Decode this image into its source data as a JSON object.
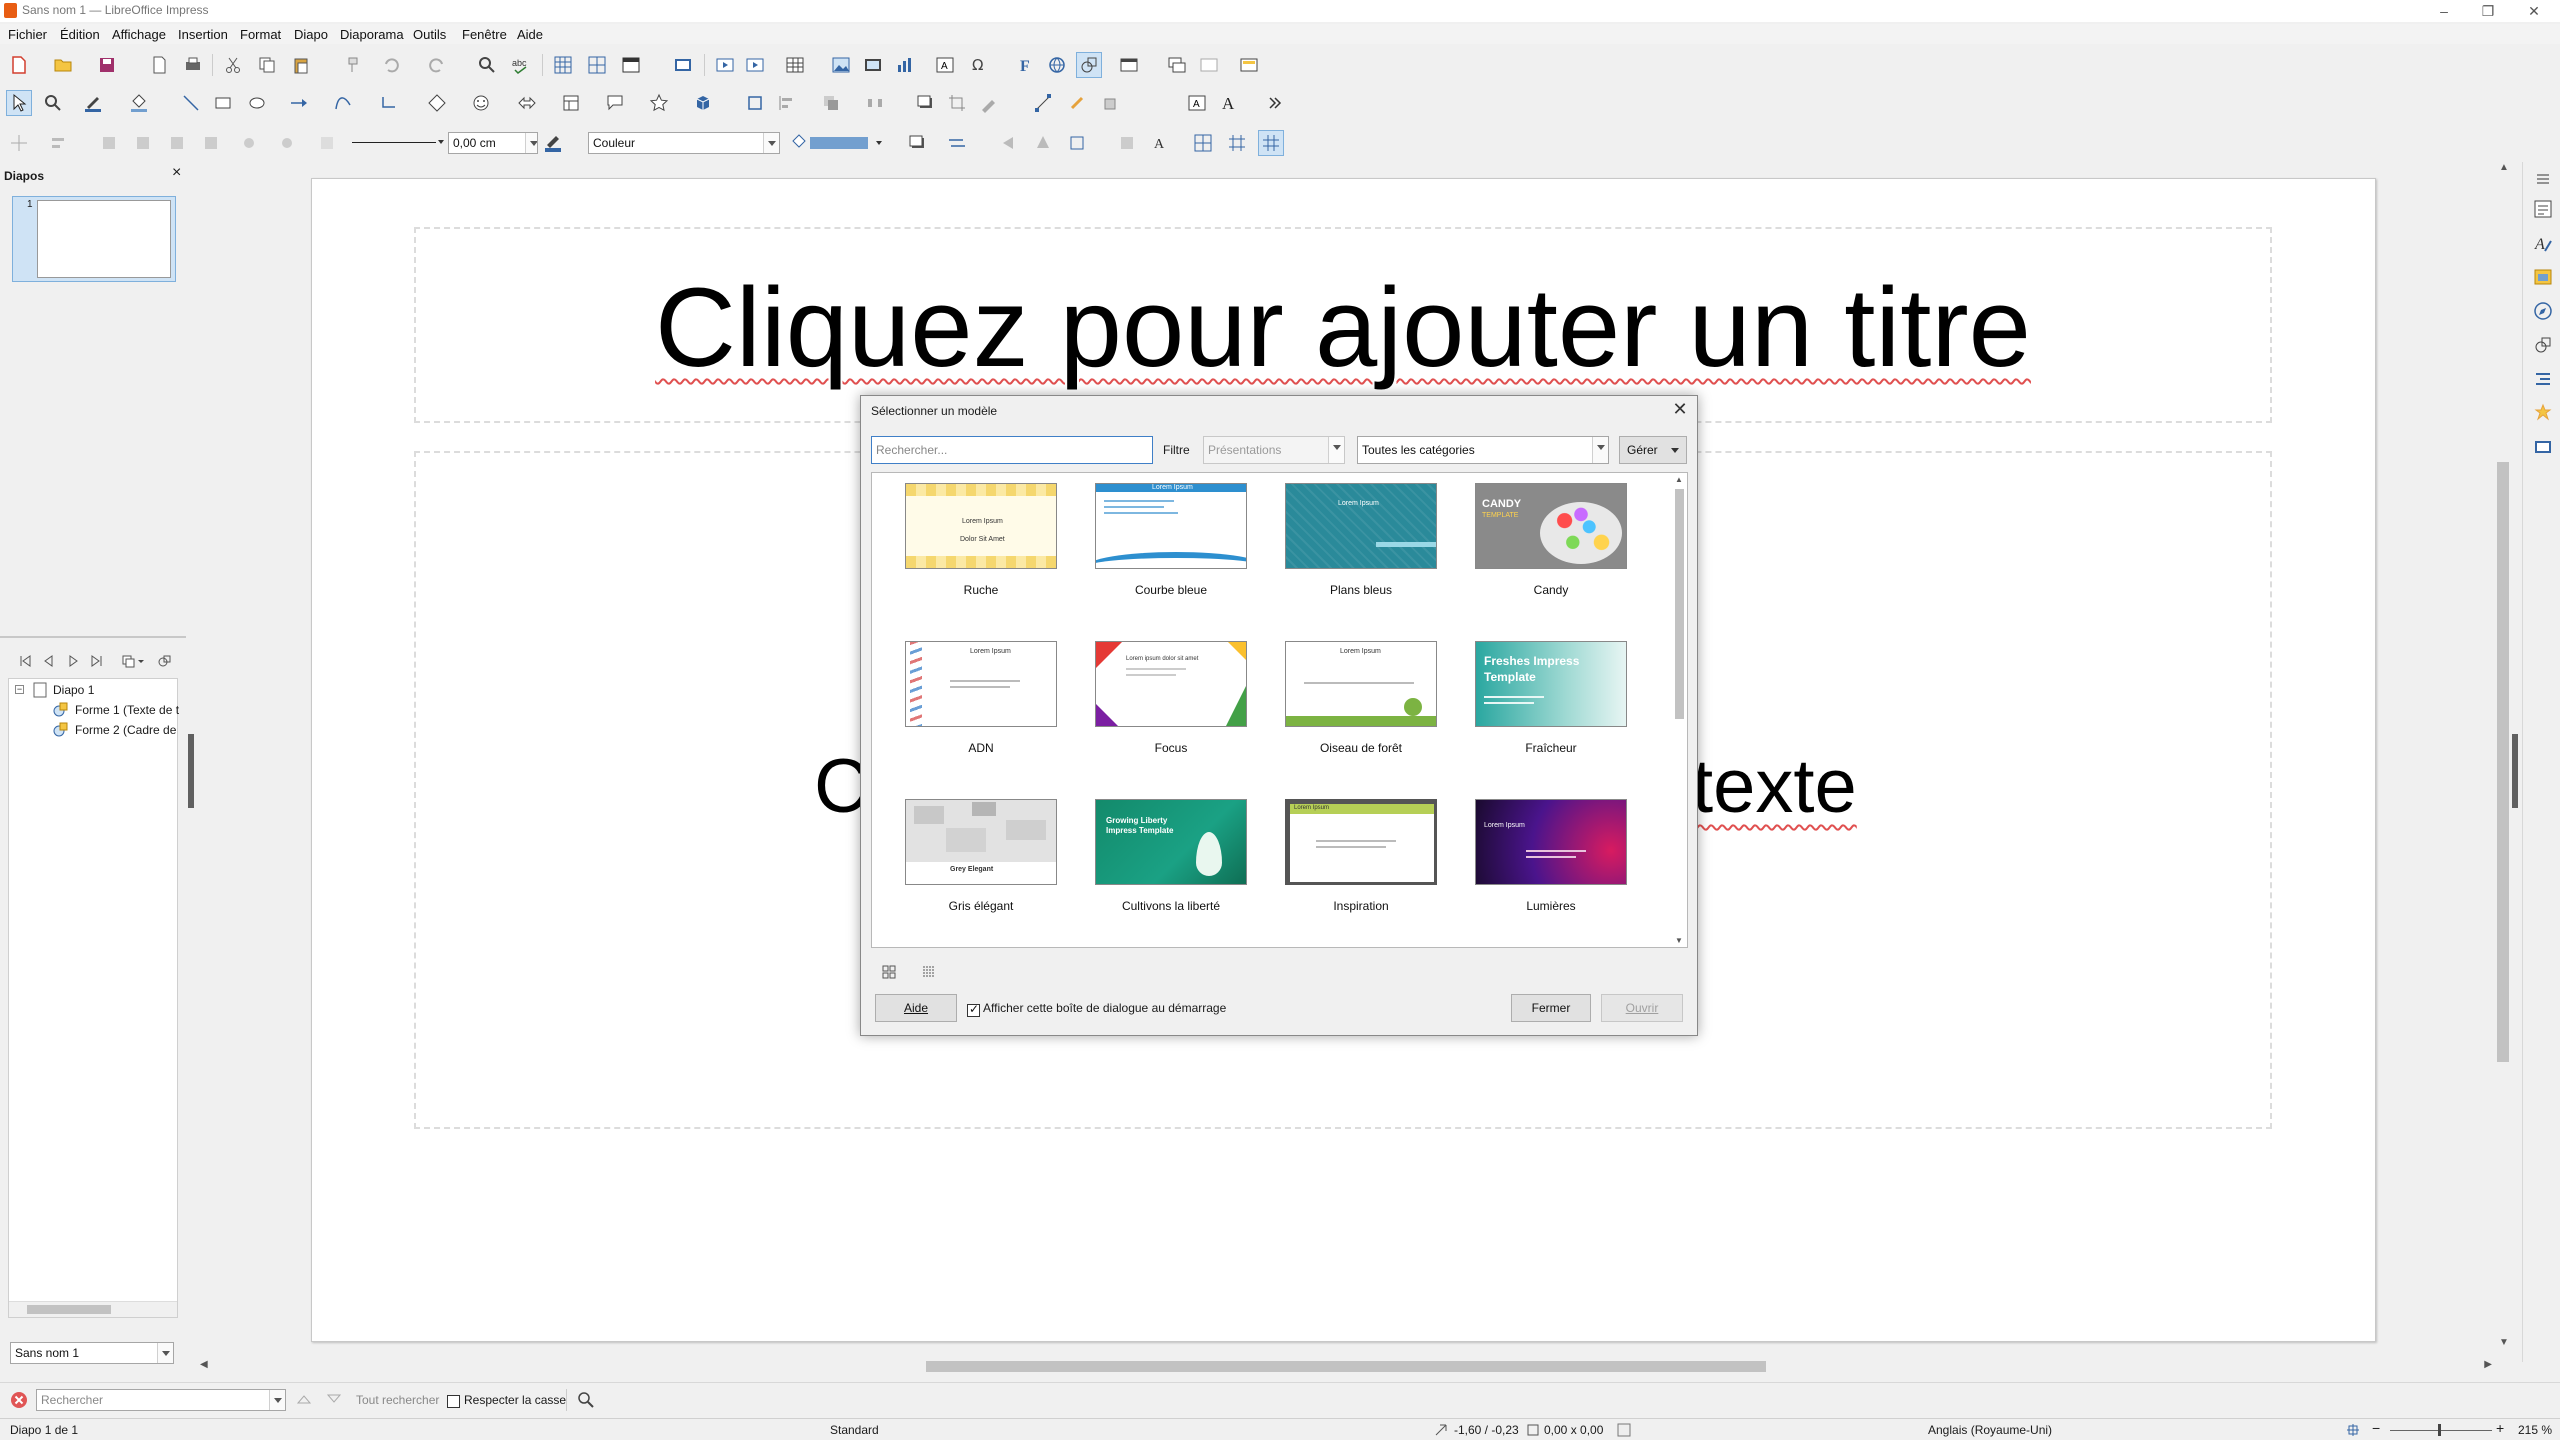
{
  "window": {
    "title": "Sans nom 1 — LibreOffice Impress",
    "controls": [
      "–",
      "❐",
      "✕"
    ]
  },
  "menubar": [
    {
      "label": "Fichier"
    },
    {
      "label": "Édition"
    },
    {
      "label": "Affichage"
    },
    {
      "label": "Insertion"
    },
    {
      "label": "Format"
    },
    {
      "label": "Diapo"
    },
    {
      "label": "Diaporama"
    },
    {
      "label": "Outils"
    },
    {
      "label": "Fenêtre"
    },
    {
      "label": "Aide"
    }
  ],
  "toolbar3": {
    "line_width": "0,00 cm",
    "fill_type": "Couleur",
    "fill_color": "#729fcf",
    "line_color": "#3465a4"
  },
  "slides_panel": {
    "title": "Diapos",
    "close": "×",
    "slide_number": "1"
  },
  "navigator": {
    "tree": [
      {
        "label": "Diapo 1",
        "level": 0
      },
      {
        "label": "Forme 1 (Texte de t",
        "level": 1
      },
      {
        "label": "Forme 2 (Cadre de",
        "level": 1
      }
    ],
    "document_select": "Sans nom 1"
  },
  "slide": {
    "title_placeholder": "Cliquez pour ajouter un titre",
    "body_left": "C",
    "body_right": "texte"
  },
  "dialog": {
    "title": "Sélectionner un modèle",
    "search_placeholder": "Rechercher...",
    "filter_label": "Filtre",
    "filter_value": "Présentations",
    "category_value": "Toutes les catégories",
    "manage_button": "Gérer",
    "templates": [
      {
        "name": "Ruche",
        "preview": [
          "Lorem Ipsum",
          "Dolor Sit Amet"
        ]
      },
      {
        "name": "Courbe bleue",
        "preview": [
          "Lorem Ipsum"
        ]
      },
      {
        "name": "Plans bleus",
        "preview": [
          "Lorem Ipsum"
        ]
      },
      {
        "name": "Candy",
        "preview": [
          "CANDY",
          "TEMPLATE"
        ]
      },
      {
        "name": "ADN",
        "preview": [
          "Lorem Ipsum"
        ]
      },
      {
        "name": "Focus",
        "preview": [
          "Lorem ipsum dolor sit amet"
        ]
      },
      {
        "name": "Oiseau de forêt",
        "preview": [
          "Lorem Ipsum"
        ]
      },
      {
        "name": "Fraîcheur",
        "preview": [
          "Freshes Impress",
          "Template"
        ]
      },
      {
        "name": "Gris élégant",
        "preview": [
          "Grey Elegant"
        ]
      },
      {
        "name": "Cultivons la liberté",
        "preview": [
          "Growing Liberty",
          "Impress Template"
        ]
      },
      {
        "name": "Inspiration",
        "preview": [
          "Lorem Ipsum"
        ]
      },
      {
        "name": "Lumières",
        "preview": [
          "Lorem Ipsum"
        ]
      }
    ],
    "help_button": "Aide",
    "show_on_startup_label": "Afficher cette boîte de dialogue au démarrage",
    "show_on_startup": true,
    "close_button": "Fermer",
    "open_button": "Ouvrir",
    "close_x": "✕"
  },
  "findbar": {
    "search_placeholder": "Rechercher",
    "find_all": "Tout rechercher",
    "match_case": "Respecter la casse"
  },
  "statusbar": {
    "slide_info": "Diapo 1 de 1",
    "master": "Standard",
    "position": "-1,60 / -0,23",
    "size": "0,00 x 0,00",
    "language": "Anglais (Royaume-Uni)",
    "zoom": "215 %"
  }
}
